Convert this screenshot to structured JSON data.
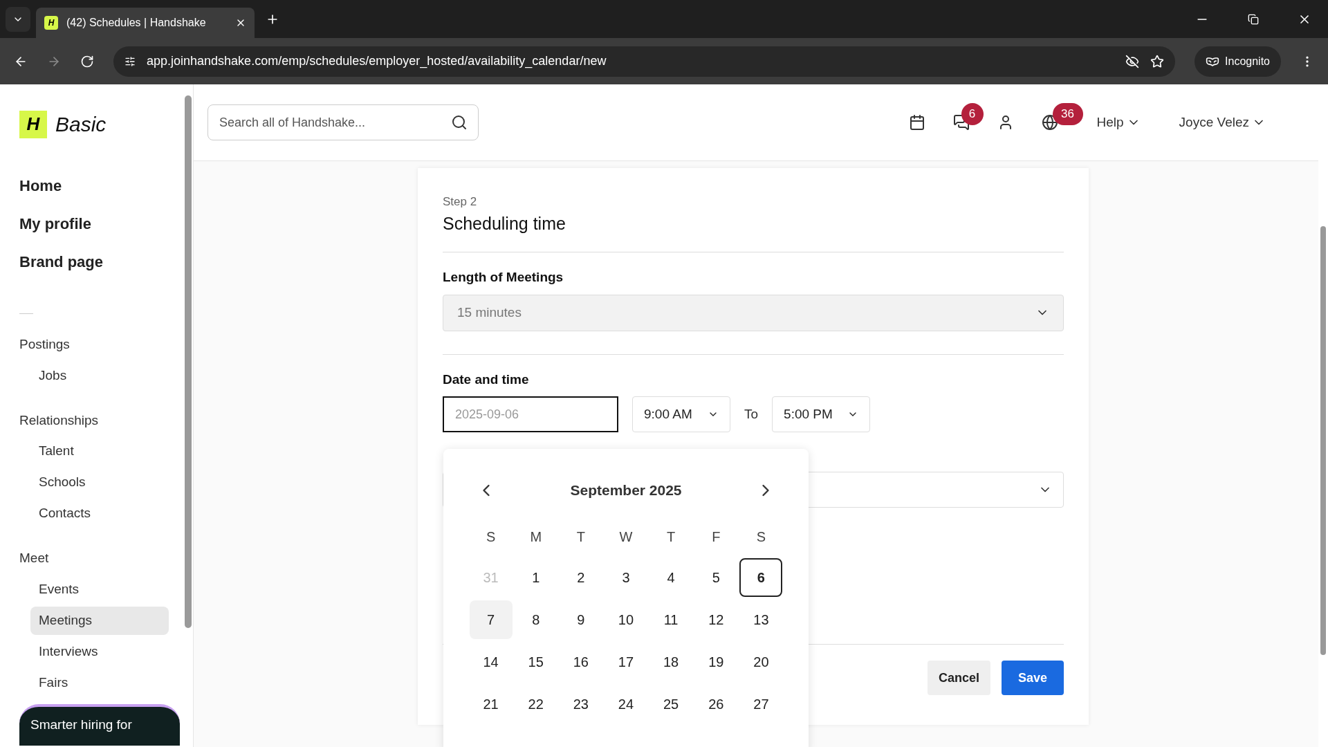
{
  "browser": {
    "tab_title": "(42) Schedules | Handshake",
    "url": "app.joinhandshake.com/emp/schedules/employer_hosted/availability_calendar/new",
    "profile": "Incognito",
    "favicon": "H"
  },
  "brand": {
    "logo": "H",
    "plan": "Basic"
  },
  "search": {
    "placeholder": "Search all of Handshake..."
  },
  "header": {
    "messages_badge": "6",
    "globe_badge": "36",
    "help": "Help",
    "user": "Joyce Velez"
  },
  "sidebar": {
    "main": [
      {
        "label": "Home"
      },
      {
        "label": "My profile"
      },
      {
        "label": "Brand page"
      }
    ],
    "sections": [
      {
        "label": "Postings",
        "children": [
          {
            "label": "Jobs",
            "selected": false
          }
        ]
      },
      {
        "label": "Relationships",
        "children": [
          {
            "label": "Talent",
            "selected": false
          },
          {
            "label": "Schools",
            "selected": false
          },
          {
            "label": "Contacts",
            "selected": false
          }
        ]
      },
      {
        "label": "Meet",
        "children": [
          {
            "label": "Events",
            "selected": false
          },
          {
            "label": "Meetings",
            "selected": true
          },
          {
            "label": "Interviews",
            "selected": false
          },
          {
            "label": "Fairs",
            "selected": false
          }
        ]
      }
    ],
    "promo": "Smarter hiring for"
  },
  "form": {
    "step": "Step 2",
    "title": "Scheduling time",
    "length_label": "Length of Meetings",
    "length_value": "15 minutes",
    "date_label": "Date and time",
    "date_placeholder": "2025-09-06",
    "start_time": "9:00 AM",
    "to": "To",
    "end_time": "5:00 PM",
    "cancel": "Cancel",
    "save": "Save"
  },
  "calendar": {
    "month": "September 2025",
    "weekdays": [
      "S",
      "M",
      "T",
      "W",
      "T",
      "F",
      "S"
    ],
    "weeks": [
      [
        {
          "label": "31",
          "outside": true,
          "selected": false,
          "hovered": false
        },
        {
          "label": "1",
          "outside": false,
          "selected": false,
          "hovered": false
        },
        {
          "label": "2",
          "outside": false,
          "selected": false,
          "hovered": false
        },
        {
          "label": "3",
          "outside": false,
          "selected": false,
          "hovered": false
        },
        {
          "label": "4",
          "outside": false,
          "selected": false,
          "hovered": false
        },
        {
          "label": "5",
          "outside": false,
          "selected": false,
          "hovered": false
        },
        {
          "label": "6",
          "outside": false,
          "selected": true,
          "hovered": false
        }
      ],
      [
        {
          "label": "7",
          "outside": false,
          "selected": false,
          "hovered": true
        },
        {
          "label": "8",
          "outside": false,
          "selected": false,
          "hovered": false
        },
        {
          "label": "9",
          "outside": false,
          "selected": false,
          "hovered": false
        },
        {
          "label": "10",
          "outside": false,
          "selected": false,
          "hovered": false
        },
        {
          "label": "11",
          "outside": false,
          "selected": false,
          "hovered": false
        },
        {
          "label": "12",
          "outside": false,
          "selected": false,
          "hovered": false
        },
        {
          "label": "13",
          "outside": false,
          "selected": false,
          "hovered": false
        }
      ],
      [
        {
          "label": "14",
          "outside": false,
          "selected": false,
          "hovered": false
        },
        {
          "label": "15",
          "outside": false,
          "selected": false,
          "hovered": false
        },
        {
          "label": "16",
          "outside": false,
          "selected": false,
          "hovered": false
        },
        {
          "label": "17",
          "outside": false,
          "selected": false,
          "hovered": false
        },
        {
          "label": "18",
          "outside": false,
          "selected": false,
          "hovered": false
        },
        {
          "label": "19",
          "outside": false,
          "selected": false,
          "hovered": false
        },
        {
          "label": "20",
          "outside": false,
          "selected": false,
          "hovered": false
        }
      ],
      [
        {
          "label": "21",
          "outside": false,
          "selected": false,
          "hovered": false
        },
        {
          "label": "22",
          "outside": false,
          "selected": false,
          "hovered": false
        },
        {
          "label": "23",
          "outside": false,
          "selected": false,
          "hovered": false
        },
        {
          "label": "24",
          "outside": false,
          "selected": false,
          "hovered": false
        },
        {
          "label": "25",
          "outside": false,
          "selected": false,
          "hovered": false
        },
        {
          "label": "26",
          "outside": false,
          "selected": false,
          "hovered": false
        },
        {
          "label": "27",
          "outside": false,
          "selected": false,
          "hovered": false
        }
      ]
    ]
  }
}
